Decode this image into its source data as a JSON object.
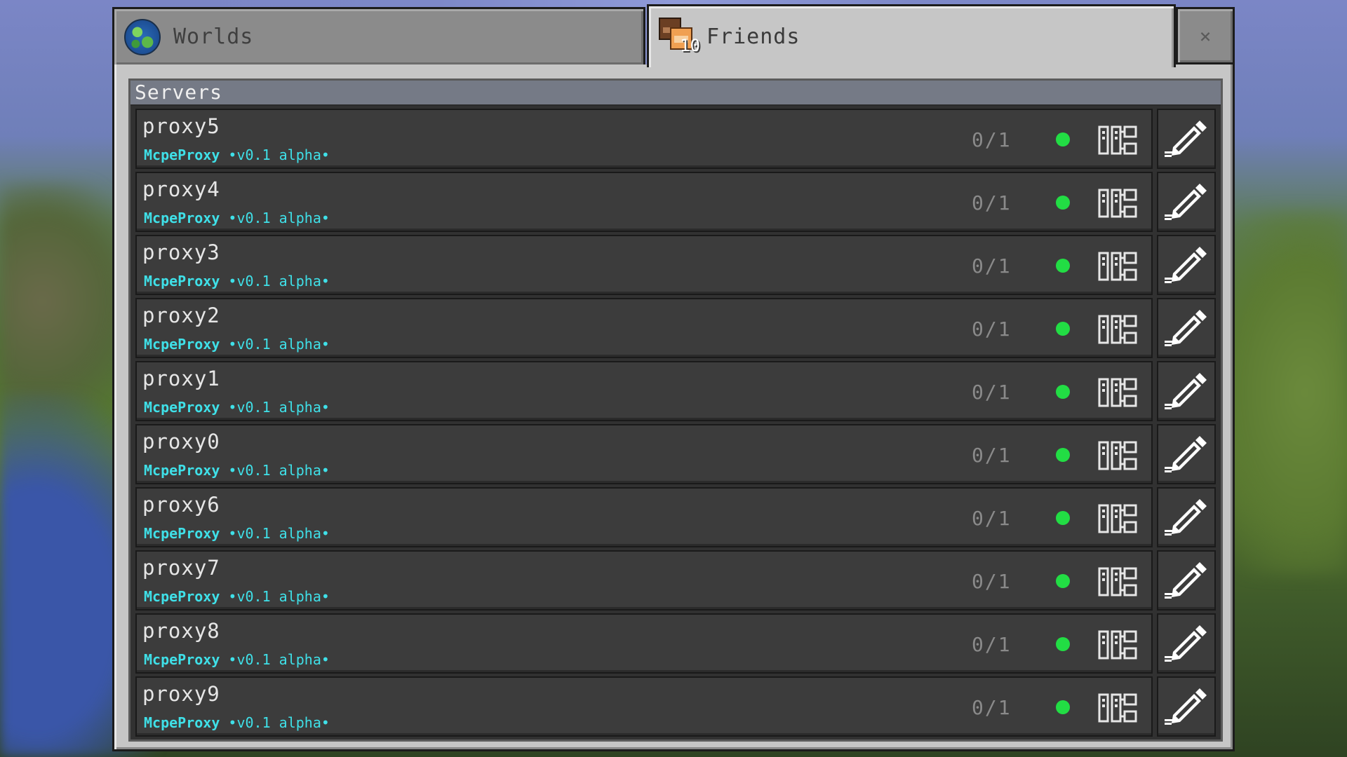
{
  "tabs": {
    "worlds": {
      "label": "Worlds",
      "icon": "globe-icon"
    },
    "friends": {
      "label": "Friends",
      "icon": "friends-icon",
      "badge": "10"
    },
    "close": {
      "symbol": "×",
      "icon": "close-icon"
    }
  },
  "servers": {
    "header": "Servers",
    "items": [
      {
        "name": "proxy5",
        "motd_brand": "McpeProxy",
        "motd_version": " •v0.1 alpha•",
        "players": "0/1",
        "status": "online"
      },
      {
        "name": "proxy4",
        "motd_brand": "McpeProxy",
        "motd_version": " •v0.1 alpha•",
        "players": "0/1",
        "status": "online"
      },
      {
        "name": "proxy3",
        "motd_brand": "McpeProxy",
        "motd_version": " •v0.1 alpha•",
        "players": "0/1",
        "status": "online"
      },
      {
        "name": "proxy2",
        "motd_brand": "McpeProxy",
        "motd_version": " •v0.1 alpha•",
        "players": "0/1",
        "status": "online"
      },
      {
        "name": "proxy1",
        "motd_brand": "McpeProxy",
        "motd_version": " •v0.1 alpha•",
        "players": "0/1",
        "status": "online"
      },
      {
        "name": "proxy0",
        "motd_brand": "McpeProxy",
        "motd_version": " •v0.1 alpha•",
        "players": "0/1",
        "status": "online"
      },
      {
        "name": "proxy6",
        "motd_brand": "McpeProxy",
        "motd_version": " •v0.1 alpha•",
        "players": "0/1",
        "status": "online"
      },
      {
        "name": "proxy7",
        "motd_brand": "McpeProxy",
        "motd_version": " •v0.1 alpha•",
        "players": "0/1",
        "status": "online"
      },
      {
        "name": "proxy8",
        "motd_brand": "McpeProxy",
        "motd_version": " •v0.1 alpha•",
        "players": "0/1",
        "status": "online"
      },
      {
        "name": "proxy9",
        "motd_brand": "McpeProxy",
        "motd_version": " •v0.1 alpha•",
        "players": "0/1",
        "status": "online"
      }
    ]
  },
  "colors": {
    "motd": "#3fe0e8",
    "status_online": "#22dd44",
    "row_bg": "#3c3c3c",
    "header_bg": "#757a86"
  }
}
